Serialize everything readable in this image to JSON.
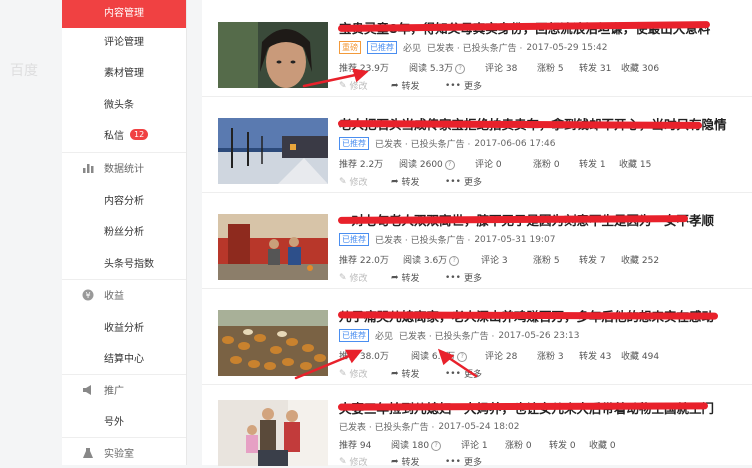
{
  "watermark": "百度",
  "sidebar": {
    "items": [
      {
        "label": "内容管理"
      },
      {
        "label": "评论管理"
      },
      {
        "label": "素材管理"
      },
      {
        "label": "微头条"
      },
      {
        "label": "私信",
        "badge": "12"
      }
    ],
    "groups": [
      {
        "label": "数据统计",
        "icon": "bar-chart-icon",
        "items": [
          {
            "label": "内容分析"
          },
          {
            "label": "粉丝分析"
          },
          {
            "label": "头条号指数"
          }
        ]
      },
      {
        "label": "收益",
        "icon": "yen-icon",
        "items": [
          {
            "label": "收益分析"
          },
          {
            "label": "结算中心"
          }
        ]
      },
      {
        "label": "推广",
        "icon": "megaphone-icon",
        "items": [
          {
            "label": "号外"
          }
        ]
      },
      {
        "label": "实验室",
        "icon": "flask-icon",
        "items": []
      }
    ]
  },
  "accent_color": "#f04142",
  "action_labels": {
    "edit": "修改",
    "share": "转发",
    "more": "更多"
  },
  "articles": [
    {
      "title": "宝贵灵童8年，得知父母真实身份，回想流浪泪坦谦，使最出大意料",
      "tags": [
        "重磅",
        "已推荐"
      ],
      "tag_colors": [
        "orange",
        "blue"
      ],
      "mp": "必见",
      "status": "已发表 · 已投头条广告 ·",
      "date": "2017-05-29 15:42",
      "stats": {
        "recommend": "推荐 23.9万",
        "read": "阅读 5.3万",
        "comment": "评论 38",
        "fans": "涨粉 5",
        "share": "转发 31",
        "fav": "收藏 306"
      }
    },
    {
      "title": "老人把石头当成传家宝拒绝拍卖卖车，拿到钱却不开心，当时只有隐情",
      "tags": [
        "已推荐"
      ],
      "tag_colors": [
        "blue"
      ],
      "mp": "",
      "status": "已发表 · 已投头条广告 ·",
      "date": "2017-06-06 17:46",
      "stats": {
        "recommend": "推荐 2.2万",
        "read": "阅读 2600",
        "comment": "评论 0",
        "fans": "涨粉 0",
        "share": "转发 1",
        "fav": "收藏 15"
      }
    },
    {
      "title": "一对七旬老人双双离世，膝下无子是因为刻意不生是因为一女不孝顺",
      "tags": [
        "已推荐"
      ],
      "tag_colors": [
        "blue"
      ],
      "mp": "",
      "status": "已发表 · 已投头条广告 ·",
      "date": "2017-05-31 19:07",
      "stats": {
        "recommend": "推荐 22.0万",
        "read": "阅读 3.6万",
        "comment": "评论 3",
        "fans": "涨粉 5",
        "share": "转发 7",
        "fav": "收藏 252"
      }
    },
    {
      "title": "儿子痛哭儿媳离家，老人深山养鸡赚百万，多年后他的想来实在感动",
      "tags": [
        "已推荐"
      ],
      "tag_colors": [
        "blue"
      ],
      "mp": "必见",
      "status": "已发表 · 已投头条广告 ·",
      "date": "2017-05-26 23:13",
      "stats": {
        "recommend": "推荐 38.0万",
        "read": "阅读 6.9万",
        "comment": "评论 28",
        "fans": "涨粉 3",
        "share": "转发 43",
        "fav": "收藏 494"
      }
    },
    {
      "title": "夫妻三年捡到儿媳妇一大妈养，也让女儿来大后带着动物王国就王门",
      "tags": [],
      "tag_colors": [],
      "mp": "",
      "status": "已发表 · 已投头条广告 ·",
      "date": "2017-05-24 18:02",
      "stats": {
        "recommend": "推荐 94",
        "read": "阅读 180",
        "comment": "评论 1",
        "fans": "涨粉 0",
        "share": "转发 0",
        "fav": "收藏 0"
      }
    }
  ]
}
